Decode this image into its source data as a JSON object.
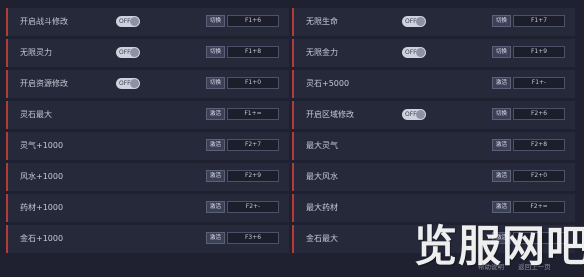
{
  "left": [
    {
      "label": "开启战斗修改",
      "control": "toggle",
      "toggle_text": "OFF",
      "action": "切换",
      "key": "F1+6"
    },
    {
      "label": "无限灵力",
      "control": "toggle",
      "toggle_text": "OFF",
      "action": "切换",
      "key": "F1+8"
    },
    {
      "label": "开启资源修改",
      "control": "toggle",
      "toggle_text": "OFF",
      "action": "切换",
      "key": "F1+0"
    },
    {
      "label": "灵石最大",
      "control": "none",
      "action": "激活",
      "key": "F1+="
    },
    {
      "label": "灵气+1000",
      "control": "none",
      "action": "激活",
      "key": "F2+7"
    },
    {
      "label": "风水+1000",
      "control": "none",
      "action": "激活",
      "key": "F2+9"
    },
    {
      "label": "药材+1000",
      "control": "none",
      "action": "激活",
      "key": "F2+-"
    },
    {
      "label": "金石+1000",
      "control": "none",
      "action": "激活",
      "key": "F3+6"
    }
  ],
  "right": [
    {
      "label": "无限生命",
      "control": "toggle",
      "toggle_text": "OFF",
      "action": "切换",
      "key": "F1+7"
    },
    {
      "label": "无限金力",
      "control": "toggle",
      "toggle_text": "OFF",
      "action": "切换",
      "key": "F1+9"
    },
    {
      "label": "灵石+5000",
      "control": "none",
      "action": "激活",
      "key": "F1+-"
    },
    {
      "label": "开启区域修改",
      "control": "toggle",
      "toggle_text": "OFF",
      "action": "切换",
      "key": "F2+6"
    },
    {
      "label": "最大灵气",
      "control": "none",
      "action": "激活",
      "key": "F2+8"
    },
    {
      "label": "最大风水",
      "control": "none",
      "action": "激活",
      "key": "F2+0"
    },
    {
      "label": "最大药材",
      "control": "none",
      "action": "激活",
      "key": "F2+="
    },
    {
      "label": "金石最大",
      "control": "none",
      "action": "激活",
      "key": ""
    }
  ],
  "footer": {
    "help": "帮助说明",
    "back": "返回上一页"
  },
  "watermark": "览服网吧",
  "colors": {
    "accent": "#b53b38",
    "background": "#1f2130",
    "row": "#262939"
  }
}
